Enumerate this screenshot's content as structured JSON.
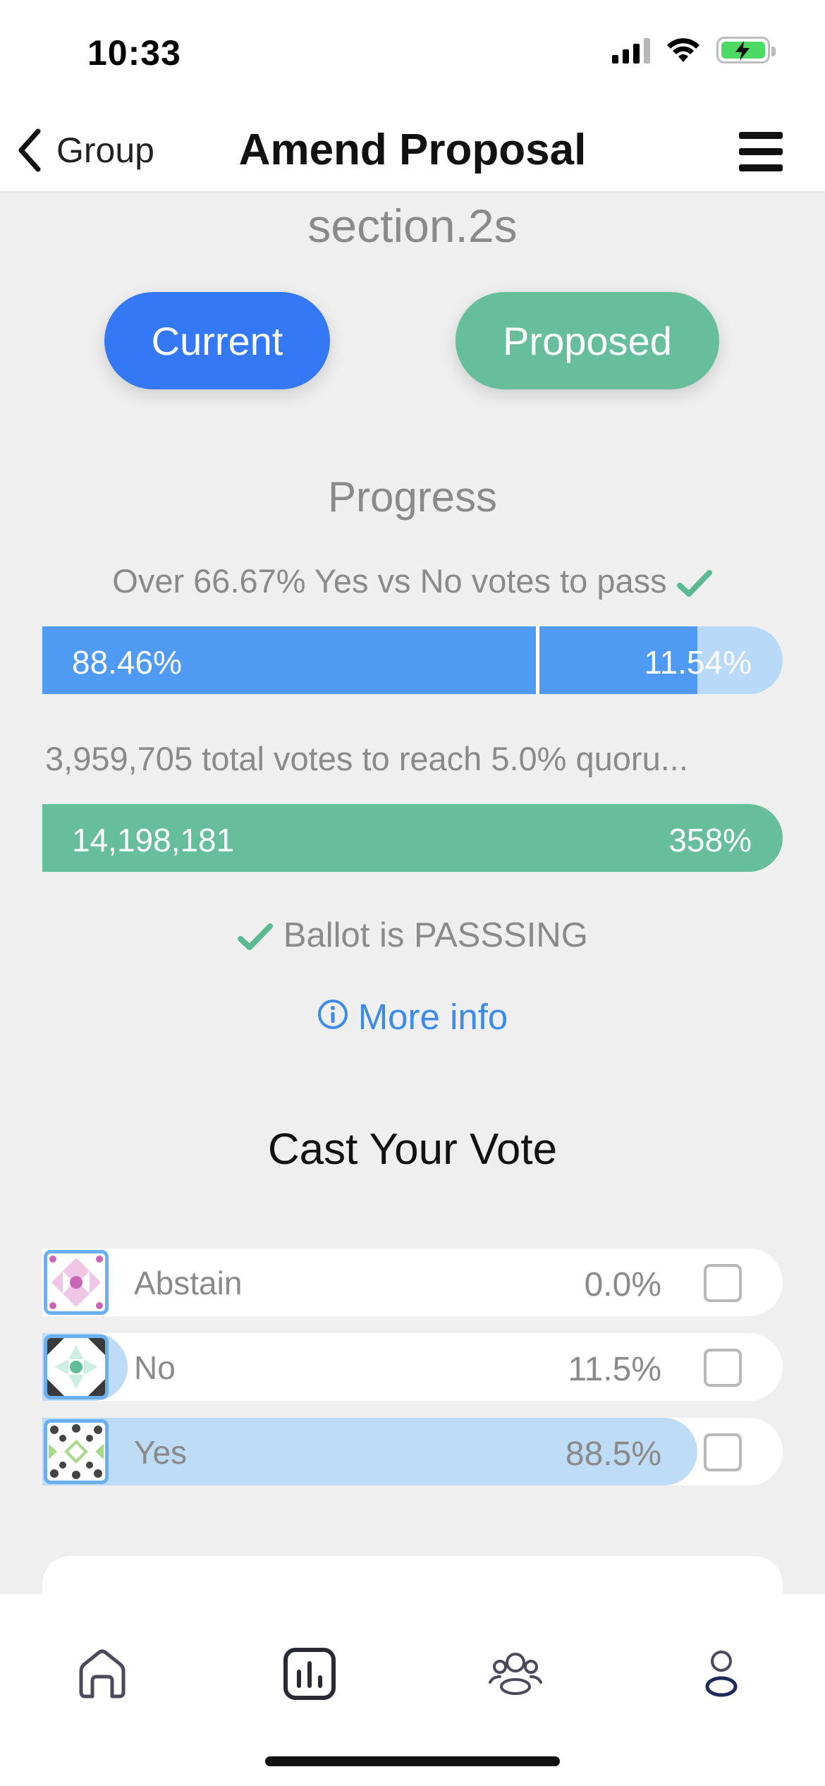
{
  "status_bar": {
    "time": "10:33",
    "icons": [
      "cellular-signal-icon",
      "wifi-icon",
      "battery-charging-icon"
    ]
  },
  "nav": {
    "back_label": "Group",
    "title": "Amend Proposal",
    "menu_icon": "hamburger-menu-icon"
  },
  "proposal": {
    "section_name": "section.2s",
    "current_label": "Current",
    "proposed_label": "Proposed"
  },
  "progress": {
    "heading": "Progress",
    "threshold_text": "Over 66.67% Yes vs No votes to pass",
    "threshold_met": true,
    "yes_pct_label": "88.46%",
    "no_pct_label": "11.54%",
    "yes_fraction": 0.8846,
    "no_fraction": 0.1154,
    "threshold_fraction": 0.6667,
    "quorum_text": "3,959,705 total votes to reach 5.0% quoru...",
    "quorum_votes_label": "14,198,181",
    "quorum_pct_label": "358%",
    "quorum_fraction": 1.0,
    "status_text": "Ballot is PASSSING",
    "more_info_label": "More info"
  },
  "vote": {
    "heading": "Cast Your Vote",
    "options": [
      {
        "label": "Abstain",
        "pct": "0.0%",
        "fraction": 0.0,
        "checked": false,
        "avatar_icon": "abstain-pattern-icon"
      },
      {
        "label": "No",
        "pct": "11.5%",
        "fraction": 0.115,
        "checked": false,
        "avatar_icon": "no-pattern-icon"
      },
      {
        "label": "Yes",
        "pct": "88.5%",
        "fraction": 0.885,
        "checked": false,
        "avatar_icon": "yes-pattern-icon"
      }
    ]
  },
  "tab_bar": {
    "tabs": [
      "home-icon",
      "stats-icon",
      "groups-icon",
      "profile-icon"
    ]
  },
  "colors": {
    "primary_blue": "#3478f6",
    "green": "#67be9c",
    "bar_blue": "#4f9af2",
    "light_blue": "#bfdcf6",
    "link_blue": "#3d8be8"
  }
}
